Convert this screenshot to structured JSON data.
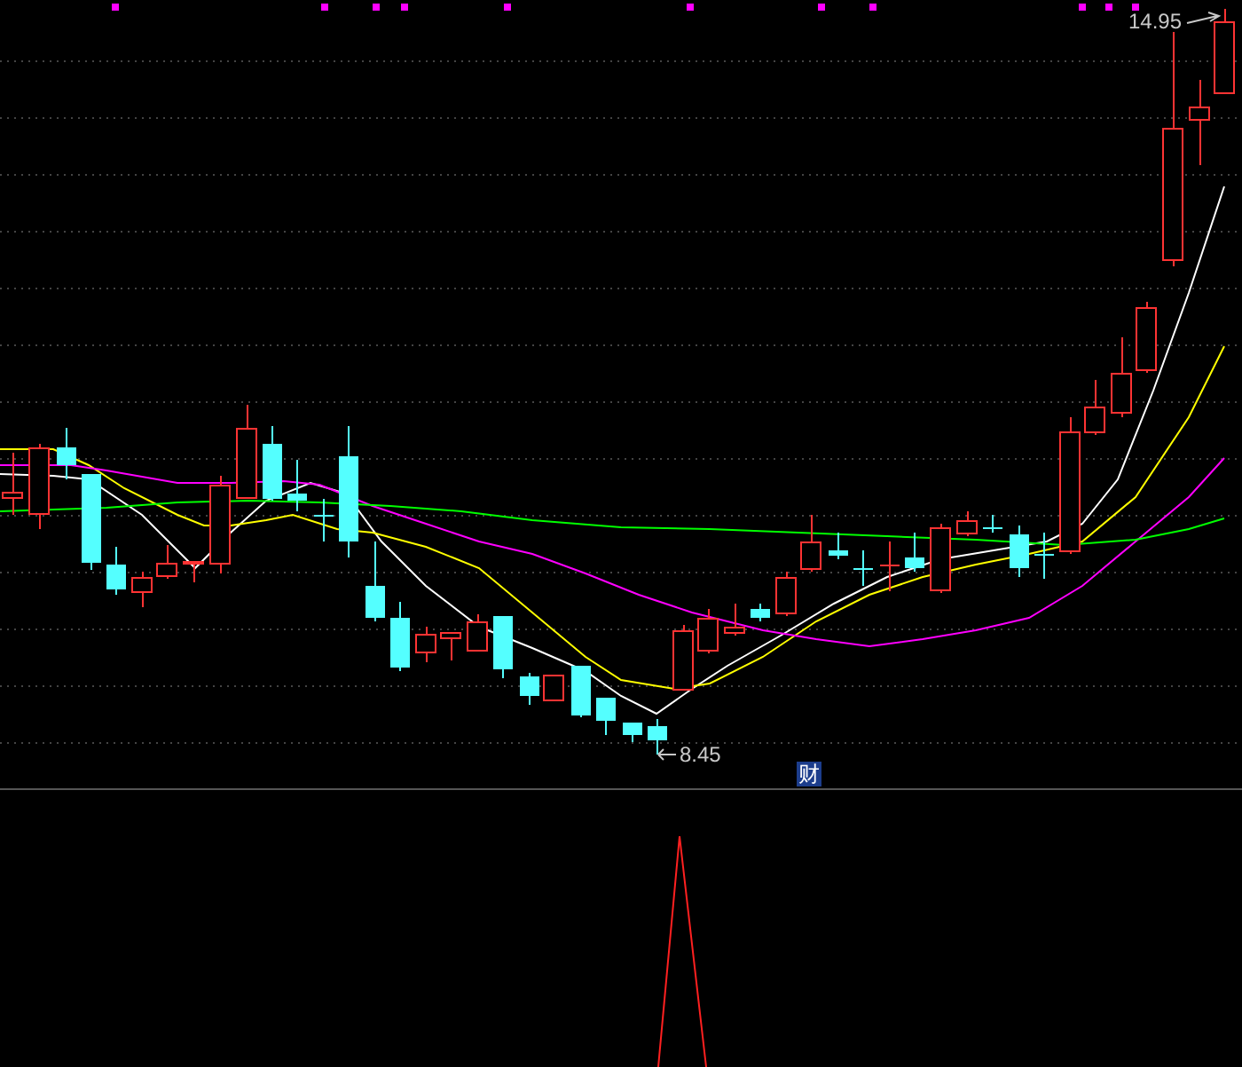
{
  "price_chart": {
    "high_label": "14.95",
    "low_label": "8.45",
    "badge": "财"
  }
}
